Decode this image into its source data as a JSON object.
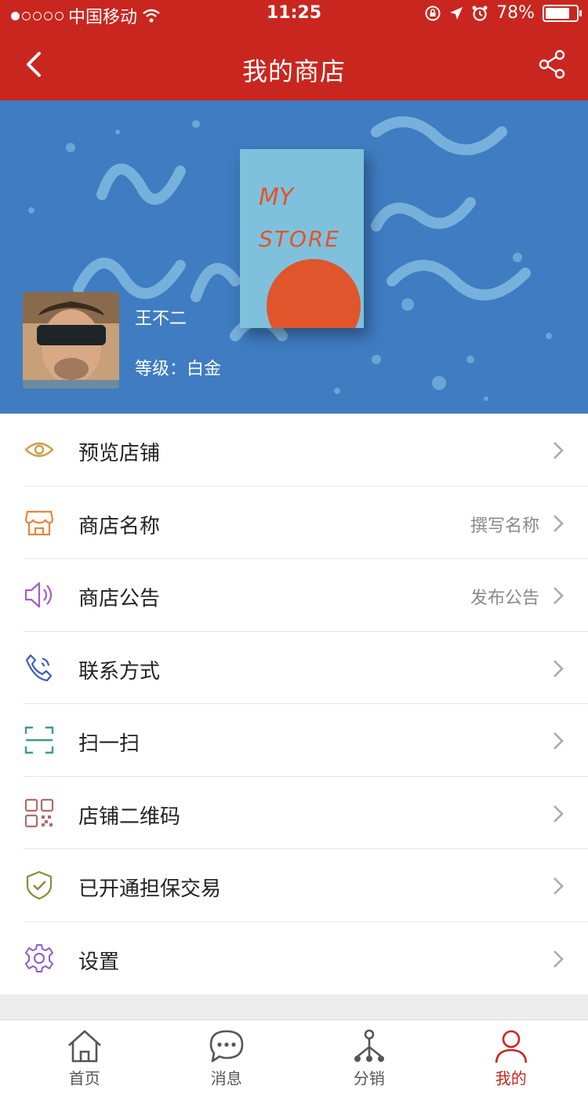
{
  "status_bar": {
    "carrier": "中国移动",
    "time": "11:25",
    "battery": "78%"
  },
  "nav": {
    "title": "我的商店"
  },
  "banner": {
    "poster_line1": "MY",
    "poster_line2": "STORE",
    "username": "王不二",
    "level": "等级：白金"
  },
  "menu": [
    {
      "label": "预览店铺",
      "value": "",
      "icon": "eye-icon",
      "color": "#c9a04a"
    },
    {
      "label": "商店名称",
      "value": "撰写名称",
      "icon": "store-icon",
      "color": "#e8853a"
    },
    {
      "label": "商店公告",
      "value": "发布公告",
      "icon": "speaker-icon",
      "color": "#a65cc8"
    },
    {
      "label": "联系方式",
      "value": "",
      "icon": "phone-icon",
      "color": "#3b5cbf"
    },
    {
      "label": "扫一扫",
      "value": "",
      "icon": "scan-icon",
      "color": "#3aa07a"
    },
    {
      "label": "店铺二维码",
      "value": "",
      "icon": "qrcode-icon",
      "color": "#b46a6a"
    },
    {
      "label": "已开通担保交易",
      "value": "",
      "icon": "shield-check-icon",
      "color": "#8a8a3a"
    },
    {
      "label": "设置",
      "value": "",
      "icon": "gear-icon",
      "color": "#8a5cc8"
    }
  ],
  "tabs": [
    {
      "label": "首页",
      "icon": "home-icon"
    },
    {
      "label": "消息",
      "icon": "chat-icon"
    },
    {
      "label": "分销",
      "icon": "distribution-icon"
    },
    {
      "label": "我的",
      "icon": "user-icon",
      "active": true
    }
  ],
  "colors": {
    "brand_red": "#c9261f",
    "banner_blue": "#3f7cc1"
  }
}
